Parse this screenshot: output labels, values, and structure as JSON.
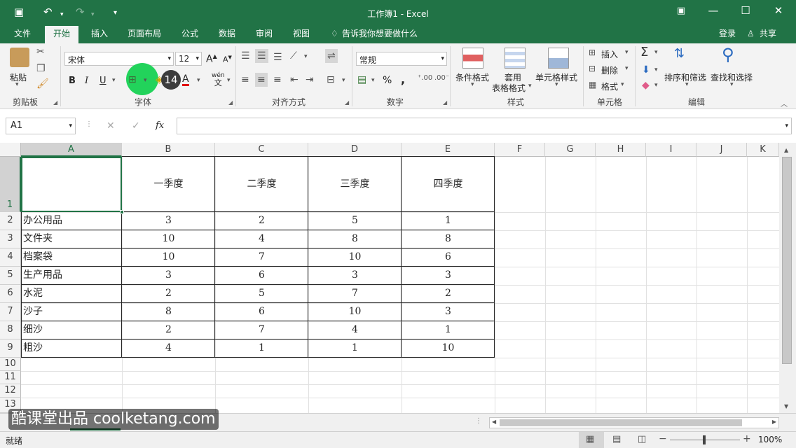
{
  "title": "工作簿1 - Excel",
  "quick_access": {
    "save_icon": "save-icon",
    "undo_icon": "undo-icon",
    "redo_icon": "redo-icon"
  },
  "menu": {
    "tabs": [
      "文件",
      "开始",
      "插入",
      "页面布局",
      "公式",
      "数据",
      "审阅",
      "视图"
    ],
    "tell_me": "告诉我你想要做什么",
    "signin": "登录",
    "share": "共享"
  },
  "ribbon": {
    "clipboard": {
      "paste": "粘贴",
      "group": "剪贴板"
    },
    "font": {
      "name": "宋体",
      "size": "12",
      "bold": "B",
      "italic": "I",
      "underline": "U",
      "phonetic_top": "wén",
      "phonetic_bottom": "文",
      "grow": "A",
      "shrink": "A",
      "color_a": "A",
      "group": "字体",
      "badge": "14"
    },
    "align": {
      "group": "对齐方式"
    },
    "number": {
      "format": "常规",
      "percent": "%",
      "comma": ",",
      "group": "数字"
    },
    "styles": {
      "conditional": "条件格式",
      "table1": "套用",
      "table2": "表格格式",
      "cellstyle": "单元格样式",
      "group": "样式"
    },
    "cells": {
      "insert": "插入",
      "delete": "删除",
      "format": "格式",
      "group": "单元格"
    },
    "editing": {
      "sort": "排序和筛选",
      "find": "查找和选择",
      "group": "编辑"
    }
  },
  "formula_bar": {
    "name_box": "A1",
    "fx": "fx",
    "value": ""
  },
  "columns": [
    "A",
    "B",
    "C",
    "D",
    "E",
    "F",
    "G",
    "H",
    "I",
    "J",
    "K"
  ],
  "rows": [
    "1",
    "2",
    "3",
    "4",
    "5",
    "6",
    "7",
    "8",
    "9",
    "10",
    "11",
    "12",
    "13"
  ],
  "table": {
    "headers": [
      "一季度",
      "二季度",
      "三季度",
      "四季度"
    ],
    "data": [
      [
        "办公用品",
        "3",
        "2",
        "5",
        "1"
      ],
      [
        "文件夹",
        "10",
        "4",
        "8",
        "8"
      ],
      [
        "档案袋",
        "10",
        "7",
        "10",
        "6"
      ],
      [
        "生产用品",
        "3",
        "6",
        "3",
        "3"
      ],
      [
        "水泥",
        "2",
        "5",
        "7",
        "2"
      ],
      [
        "沙子",
        "8",
        "6",
        "10",
        "3"
      ],
      [
        "细沙",
        "2",
        "7",
        "4",
        "1"
      ],
      [
        "粗沙",
        "4",
        "1",
        "1",
        "10"
      ]
    ]
  },
  "status": {
    "ready": "就绪",
    "zoom": "100%"
  },
  "watermark": "酷课堂出品 coolketang.com",
  "colors": {
    "accent": "#217346",
    "highlight": "#22d35b",
    "selection": "#217346"
  }
}
